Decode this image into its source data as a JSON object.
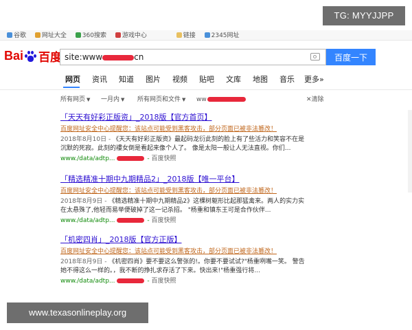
{
  "overlay": {
    "badge": "TG: MYYJJPP",
    "watermark": "www.texasonlineplay.org"
  },
  "bookmarks": [
    "谷歌",
    "网址大全",
    "360搜索",
    "游戏中心",
    "链接",
    "2345网址"
  ],
  "logo": {
    "text_bai": "Bai",
    "text_du": "百度"
  },
  "search": {
    "query_prefix": "site:www",
    "query_suffix": "cn",
    "button": "百度一下"
  },
  "tabs": [
    "网页",
    "资讯",
    "知道",
    "图片",
    "视频",
    "贴吧",
    "文库",
    "地图",
    "音乐",
    "更多»"
  ],
  "filters": {
    "time_all": "所有网页",
    "month": "一月内",
    "filetype": "所有网页和文件",
    "site_prefix": "ww",
    "clear": "清除"
  },
  "results": [
    {
      "title": "「天天有好彩正版资」_2018版【官方首页】",
      "warning": "百度网址安全中心提醒您：该站点可能受到黑客攻击，部分页面已被非法篡改！",
      "date": "2018年8月10日 -",
      "abstract": "《天天有好彩正版资》最起码龙衍此刻的脸上有了些活力和笑容不在是沉默的死寂。此刻的䄛女倒是看起来像个人了。 像是太阳一般让人无法直视。你们...",
      "url": "www./data/adtp...",
      "snapshot": "百度快照"
    },
    {
      "title": "「精选精准十期中九期精品2」_2018版【唯一平台】",
      "warning": "百度网址安全中心提醒您：该站点可能受到黑客攻击，部分页面已被非法篡改！",
      "date": "2018年8月9日 -",
      "abstract": "《精选精准十期中九期精品2》这棵树躯形比起那猛禽来。两人的实力实在太悬殊了,他轻而易举便破掉了这一记杀招。 \"杨重和镇东王可是合作伙伴...",
      "url": "www./data/adtp...",
      "snapshot": "百度快照"
    },
    {
      "title": "「机密四肖」_2018版【官方正版】",
      "warning": "百度网址安全中心提醒您：该站点可能受到黑客攻击，部分页面已被非法篡改！",
      "date": "2018年8月9日 -",
      "abstract": "《机密四肖》要不要这么警张的!。你要不要试试?\"杨重咧嘴一笑。 警告她不得这么一样的。，我不断的挣扎求存活了下来。快出来!\"杨重强行将...",
      "url": "www./data/adtp...",
      "snapshot": "百度快照"
    }
  ],
  "colors": {
    "logo_red": "#e10601",
    "logo_blue": "#2319dc",
    "button_blue": "#3385ff",
    "link": "#2c0fd1",
    "warning": "#c0661b",
    "url_green": "#118a0b",
    "redaction": "#e8283b"
  }
}
